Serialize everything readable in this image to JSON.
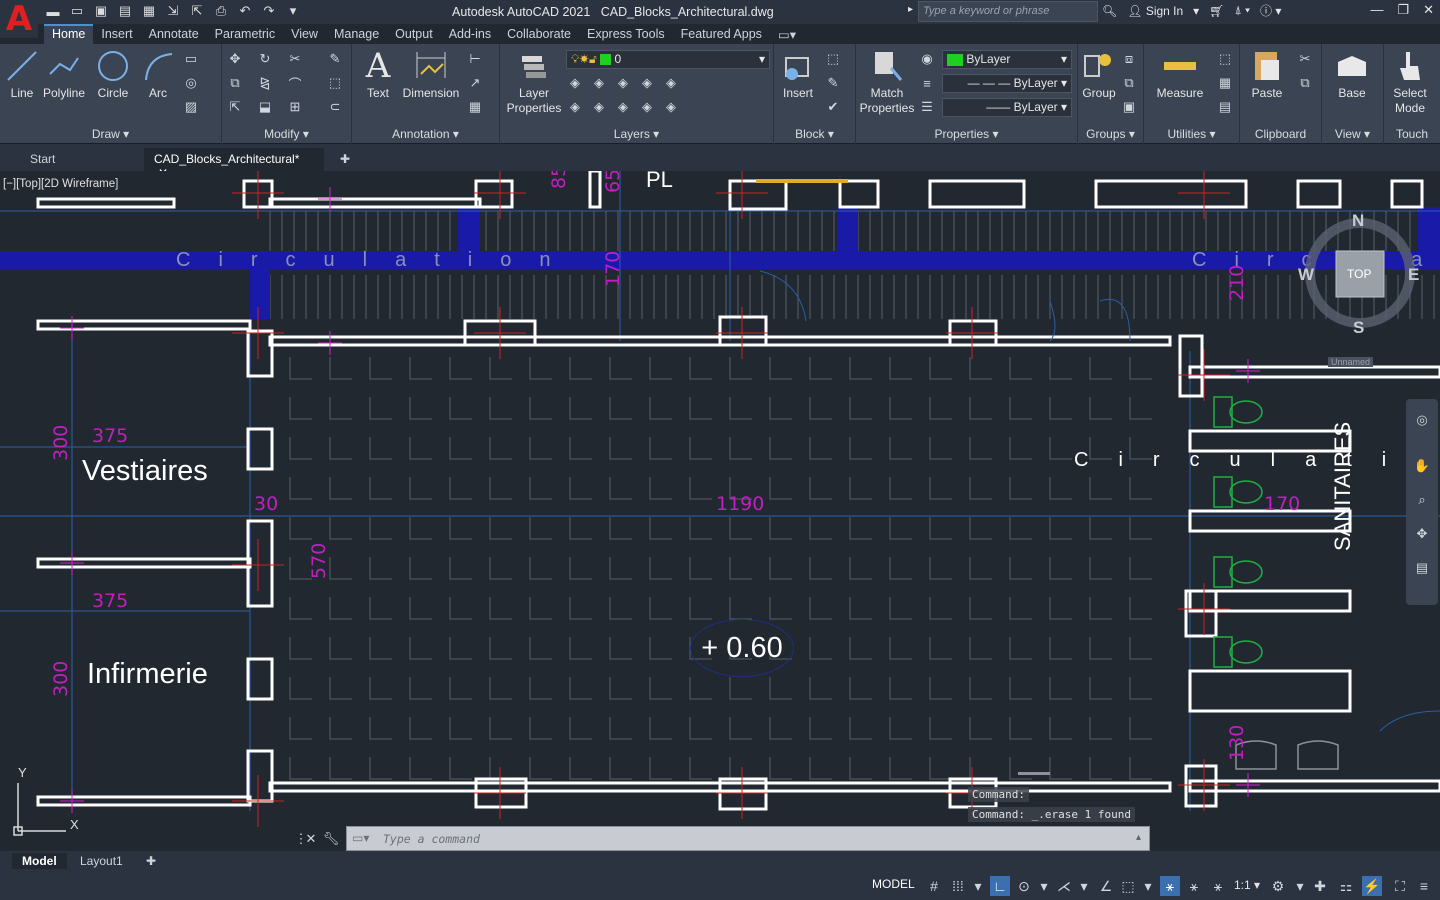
{
  "titlebar": {
    "app_title": "Autodesk AutoCAD 2021",
    "file_title": "CAD_Blocks_Architectural.dwg",
    "search_placeholder": "Type a keyword or phrase",
    "sign_in": "Sign In"
  },
  "ribbon_tabs": [
    "Home",
    "Insert",
    "Annotate",
    "Parametric",
    "View",
    "Manage",
    "Output",
    "Add-ins",
    "Collaborate",
    "Express Tools",
    "Featured Apps"
  ],
  "ribbon": {
    "draw": {
      "title": "Draw",
      "line": "Line",
      "polyline": "Polyline",
      "circle": "Circle",
      "arc": "Arc"
    },
    "modify": {
      "title": "Modify"
    },
    "annotation": {
      "title": "Annotation",
      "text": "Text",
      "dimension": "Dimension"
    },
    "layers": {
      "title": "Layers",
      "layer_properties_1": "Layer",
      "layer_properties_2": "Properties",
      "current_layer": "0"
    },
    "block": {
      "title": "Block",
      "insert": "Insert"
    },
    "properties": {
      "title": "Properties",
      "match_1": "Match",
      "match_2": "Properties",
      "color": "ByLayer",
      "linetype": "ByLayer",
      "lineweight": "ByLayer"
    },
    "groups": {
      "title": "Groups",
      "group": "Group"
    },
    "utilities": {
      "title": "Utilities",
      "measure": "Measure"
    },
    "clipboard": {
      "title": "Clipboard",
      "paste": "Paste"
    },
    "view": {
      "title": "View",
      "base": "Base"
    },
    "touch": {
      "title": "Touch",
      "select_1": "Select",
      "select_2": "Mode"
    }
  },
  "file_tabs": {
    "start": "Start",
    "active": "CAD_Blocks_Architectural*"
  },
  "canvas": {
    "view_label": "[−][Top][2D Wireframe]",
    "rooms": {
      "vestiaires": "Vestiaires",
      "infirmerie": "Infirmerie",
      "sanitaires": "SANITAIRES",
      "pl": "PL"
    },
    "circulation_top_left": "Circulation",
    "circulation_top_right": "Circulati",
    "circulation_mid": "Circulation",
    "elevation": "+ 0.60",
    "dims": {
      "d375a": "375",
      "d300a": "300",
      "d375b": "375",
      "d300b": "300",
      "d30": "30",
      "d570": "570",
      "d1190": "1190",
      "d170": "170",
      "d210": "210",
      "d130": "130",
      "d170b": "170",
      "d85": "85",
      "d65": "65"
    },
    "viewcube": {
      "n": "N",
      "s": "S",
      "e": "E",
      "w": "W",
      "top": "TOP",
      "unnamed": "Unnamed"
    },
    "ucs": {
      "x": "X",
      "y": "Y"
    }
  },
  "command": {
    "history_1": "Command:",
    "history_2": "Command: _.erase 1 found",
    "placeholder": "Type a command"
  },
  "layout_tabs": {
    "model": "Model",
    "layout1": "Layout1"
  },
  "statusbar": {
    "model": "MODEL",
    "scale": "1:1"
  }
}
